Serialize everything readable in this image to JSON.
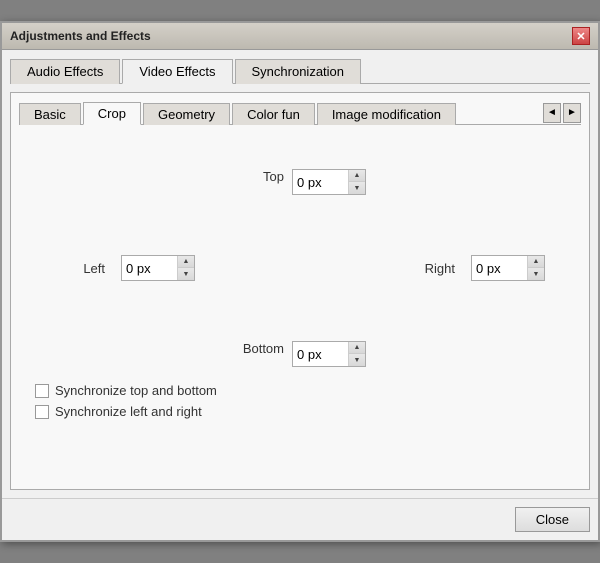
{
  "dialog": {
    "title": "Adjustments and Effects",
    "close_icon": "✕"
  },
  "main_tabs": [
    {
      "label": "Audio Effects",
      "active": false
    },
    {
      "label": "Video Effects",
      "active": true
    },
    {
      "label": "Synchronization",
      "active": false
    }
  ],
  "sub_tabs": [
    {
      "label": "Basic",
      "active": false
    },
    {
      "label": "Crop",
      "active": true
    },
    {
      "label": "Geometry",
      "active": false
    },
    {
      "label": "Color fun",
      "active": false
    },
    {
      "label": "Image modification",
      "active": false
    }
  ],
  "crop": {
    "top_label": "Top",
    "top_value": "0 px",
    "left_label": "Left",
    "left_value": "0 px",
    "right_label": "Right",
    "right_value": "0 px",
    "bottom_label": "Bottom",
    "bottom_value": "0 px",
    "sync_tb_label": "Synchronize top and bottom",
    "sync_lr_label": "Synchronize left and right"
  },
  "footer": {
    "close_label": "Close"
  }
}
